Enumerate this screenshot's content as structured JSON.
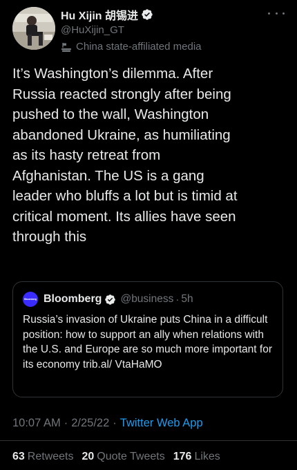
{
  "tweet": {
    "author": {
      "display_name": "Hu Xijin 胡锡进",
      "handle": "@HuXijin_GT",
      "affiliation": "China state-affiliated media",
      "verified_icon": "verified-badge-icon",
      "affiliation_icon": "podium-flag-icon"
    },
    "more_icon": "more-options-icon",
    "text": "It’s Washington’s dilemma. After\nRussia reacted strongly after being\npushed to the wall, Washington\nabandoned Ukraine, as humiliating\nas its hasty retreat from\nAfghanistan. The US is a gang\nleader who bluffs a lot but is timid at\ncritical moment. Its allies have seen\nthrough this",
    "quote": {
      "logo_text": "Bloomberg",
      "display_name": "Bloomberg",
      "handle": "@business",
      "dot": "·",
      "time": "5h",
      "text": "Russia’s invasion of Ukraine puts China in a difficult position: how to support an ally when relations with the U.S. and Europe are so much more important for its economy trib.al/ VtaHaMO"
    },
    "meta": {
      "time": "10:07 AM",
      "sep1": "·",
      "date": "2/25/22",
      "sep2": "·",
      "app": "Twitter Web App"
    },
    "stats": {
      "retweets_count": "63",
      "retweets_label": "Retweets",
      "quotes_count": "20",
      "quotes_label": "Quote Tweets",
      "likes_count": "176",
      "likes_label": "Likes"
    }
  },
  "colors": {
    "background": "#000000",
    "text_primary": "#e7e9ea",
    "text_secondary": "#71767b",
    "link": "#1d9bf0",
    "border": "#2f3336",
    "bloomberg_logo": "#3a2bff"
  }
}
